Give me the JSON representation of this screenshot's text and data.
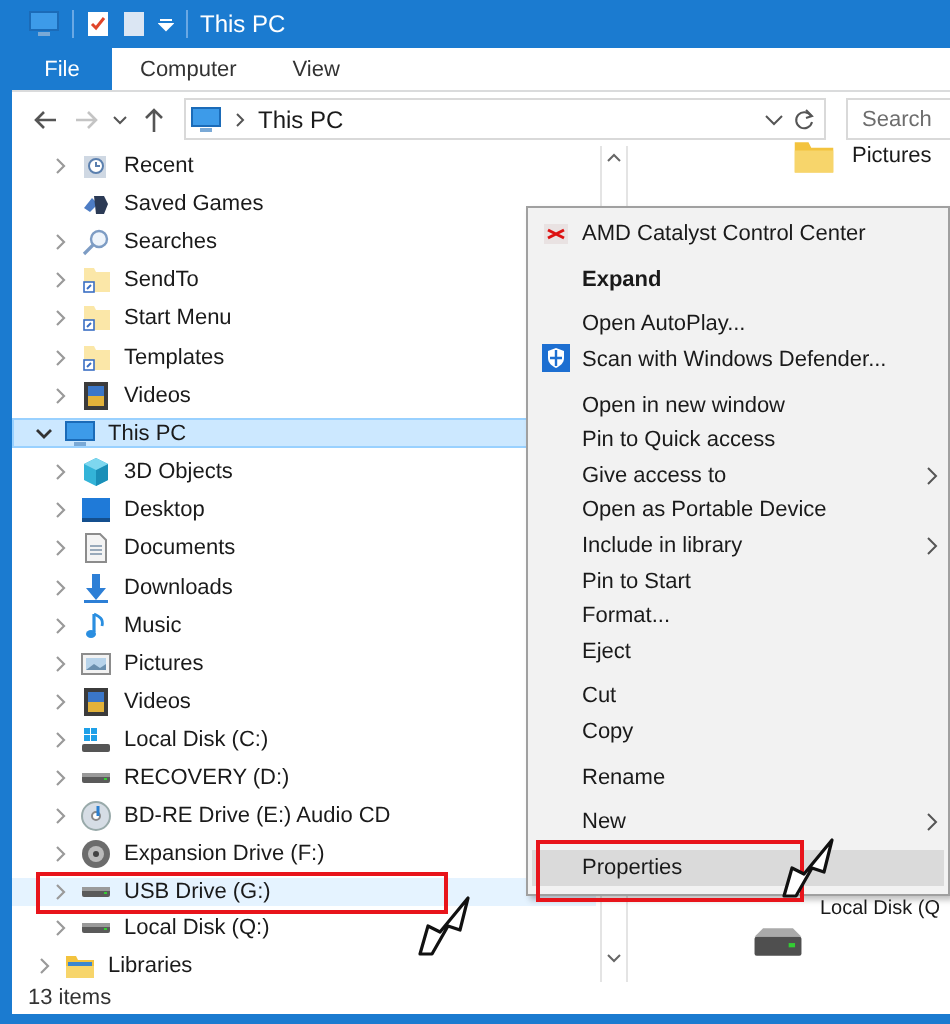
{
  "window": {
    "title": "This PC"
  },
  "ribbon_tabs": [
    {
      "label": "File",
      "kind": "file"
    },
    {
      "label": "Computer",
      "kind": "tab"
    },
    {
      "label": "View",
      "kind": "tab"
    }
  ],
  "address": {
    "path": "This PC"
  },
  "search": {
    "placeholder": "Search"
  },
  "quick_access_items": [
    {
      "label": "Recent",
      "expandable": true,
      "expanded": false,
      "selected": false,
      "hovered": false
    },
    {
      "label": "Saved Games",
      "expandable": false,
      "selected": false,
      "hovered": false
    },
    {
      "label": "Searches",
      "expandable": true,
      "expanded": false,
      "selected": false,
      "hovered": false
    },
    {
      "label": "SendTo",
      "expandable": true,
      "expanded": false,
      "selected": false,
      "hovered": false
    },
    {
      "label": "Start Menu",
      "expandable": true,
      "expanded": false,
      "selected": false,
      "hovered": false
    },
    {
      "label": "Templates",
      "expandable": true,
      "expanded": false,
      "selected": false,
      "hovered": false
    },
    {
      "label": "Videos",
      "expandable": true,
      "expanded": false,
      "selected": false,
      "hovered": false
    }
  ],
  "nav_tree": [
    {
      "label": "This PC",
      "expandable": true,
      "expanded": true,
      "selected": true,
      "hovered": false,
      "children": [
        {
          "label": "3D Objects",
          "expandable": true,
          "expanded": false,
          "selected": false,
          "hovered": false
        },
        {
          "label": "Desktop",
          "expandable": true,
          "expanded": false,
          "selected": false,
          "hovered": false
        },
        {
          "label": "Documents",
          "expandable": true,
          "expanded": false,
          "selected": false,
          "hovered": false
        },
        {
          "label": "Downloads",
          "expandable": true,
          "expanded": false,
          "selected": false,
          "hovered": false
        },
        {
          "label": "Music",
          "expandable": true,
          "expanded": false,
          "selected": false,
          "hovered": false
        },
        {
          "label": "Pictures",
          "expandable": true,
          "expanded": false,
          "selected": false,
          "hovered": false
        },
        {
          "label": "Videos",
          "expandable": true,
          "expanded": false,
          "selected": false,
          "hovered": false
        },
        {
          "label": "Local Disk (C:)",
          "expandable": true,
          "expanded": false,
          "selected": false,
          "hovered": false
        },
        {
          "label": "RECOVERY (D:)",
          "expandable": true,
          "expanded": false,
          "selected": false,
          "hovered": false
        },
        {
          "label": "BD-RE Drive (E:) Audio CD",
          "expandable": true,
          "expanded": false,
          "selected": false,
          "hovered": false
        },
        {
          "label": "Expansion Drive (F:)",
          "expandable": true,
          "expanded": false,
          "selected": false,
          "hovered": false
        },
        {
          "label": "USB Drive (G:)",
          "expandable": true,
          "expanded": false,
          "selected": false,
          "hovered": true
        },
        {
          "label": "Local Disk (Q:)",
          "expandable": true,
          "expanded": false,
          "selected": false,
          "hovered": false
        }
      ]
    },
    {
      "label": "Libraries",
      "expandable": true,
      "expanded": false,
      "selected": false,
      "hovered": false
    }
  ],
  "content_items": [
    {
      "label": "Pictures"
    },
    {
      "label": "Local Disk (Q"
    }
  ],
  "context_menu": {
    "groups": [
      [
        {
          "label": "AMD Catalyst Control Center",
          "default": false,
          "submenu": false,
          "highlighted": false
        }
      ],
      [
        {
          "label": "Expand",
          "default": true,
          "submenu": false,
          "highlighted": false
        }
      ],
      [
        {
          "label": "Open AutoPlay...",
          "default": false,
          "submenu": false,
          "highlighted": false
        },
        {
          "label": "Scan with Windows Defender...",
          "default": false,
          "submenu": false,
          "highlighted": false
        }
      ],
      [
        {
          "label": "Open in new window",
          "default": false,
          "submenu": false,
          "highlighted": false
        },
        {
          "label": "Pin to Quick access",
          "default": false,
          "submenu": false,
          "highlighted": false
        },
        {
          "label": "Give access to",
          "default": false,
          "submenu": true,
          "highlighted": false
        },
        {
          "label": "Open as Portable Device",
          "default": false,
          "submenu": false,
          "highlighted": false
        },
        {
          "label": "Include in library",
          "default": false,
          "submenu": true,
          "highlighted": false
        },
        {
          "label": "Pin to Start",
          "default": false,
          "submenu": false,
          "highlighted": false
        },
        {
          "label": "Format...",
          "default": false,
          "submenu": false,
          "highlighted": false
        },
        {
          "label": "Eject",
          "default": false,
          "submenu": false,
          "highlighted": false
        }
      ],
      [
        {
          "label": "Cut",
          "default": false,
          "submenu": false,
          "highlighted": false
        },
        {
          "label": "Copy",
          "default": false,
          "submenu": false,
          "highlighted": false
        }
      ],
      [
        {
          "label": "Rename",
          "default": false,
          "submenu": false,
          "highlighted": false
        }
      ],
      [
        {
          "label": "New",
          "default": false,
          "submenu": true,
          "highlighted": false
        }
      ],
      [
        {
          "label": "Properties",
          "default": false,
          "submenu": false,
          "highlighted": true
        }
      ]
    ]
  },
  "status_bar": {
    "text": "13 items"
  }
}
